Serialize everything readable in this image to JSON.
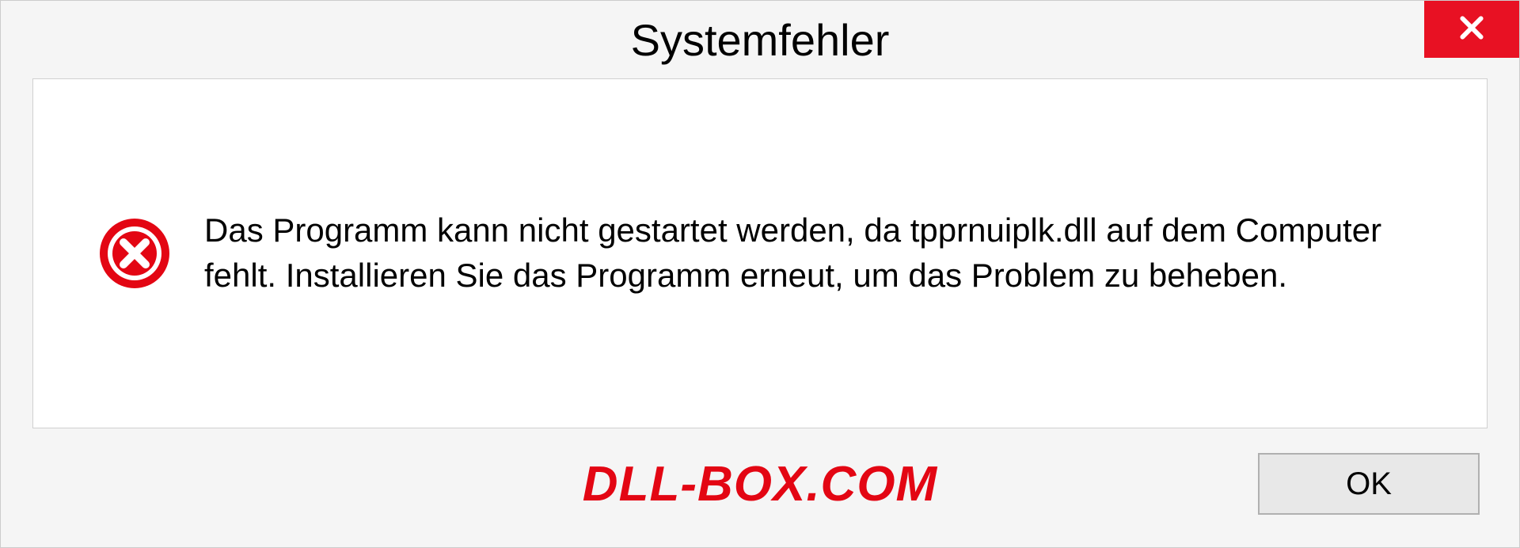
{
  "dialog": {
    "title": "Systemfehler",
    "message": "Das Programm kann nicht gestartet werden, da tpprnuiplk.dll auf dem Computer fehlt. Installieren Sie das Programm erneut, um das Problem zu beheben.",
    "ok_label": "OK"
  },
  "watermark": "DLL-BOX.COM",
  "colors": {
    "close_bg": "#e81123",
    "error_red": "#e30613"
  }
}
